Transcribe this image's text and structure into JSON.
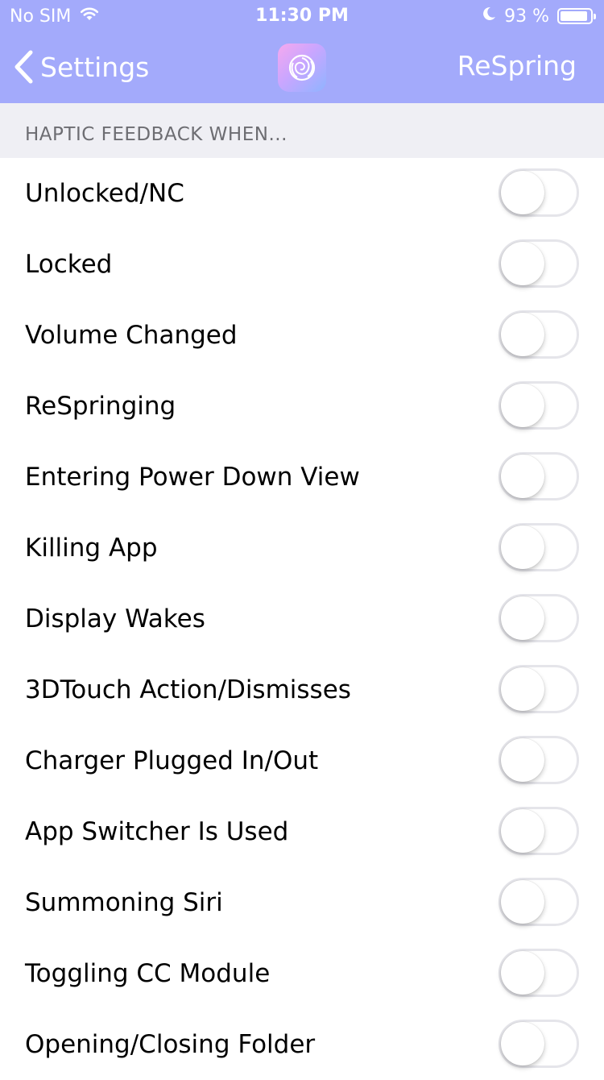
{
  "status_bar": {
    "carrier": "No SIM",
    "time": "11:30 PM",
    "battery_percent": "93 %",
    "battery_level": 0.93,
    "icons": [
      "wifi-icon",
      "moon-icon",
      "battery-icon"
    ]
  },
  "nav": {
    "back_label": "Settings",
    "app_icon": "rose-icon",
    "action_label": "ReSpring"
  },
  "section": {
    "header": "HAPTIC FEEDBACK WHEN..."
  },
  "rows": [
    {
      "label": "Unlocked/NC",
      "on": false
    },
    {
      "label": "Locked",
      "on": false
    },
    {
      "label": "Volume Changed",
      "on": false
    },
    {
      "label": "ReSpringing",
      "on": false
    },
    {
      "label": "Entering Power Down View",
      "on": false
    },
    {
      "label": "Killing App",
      "on": false
    },
    {
      "label": "Display Wakes",
      "on": false
    },
    {
      "label": "3DTouch Action/Dismisses",
      "on": false
    },
    {
      "label": "Charger Plugged In/Out",
      "on": false
    },
    {
      "label": "App Switcher Is Used",
      "on": false
    },
    {
      "label": "Summoning Siri",
      "on": false
    },
    {
      "label": "Toggling CC Module",
      "on": false
    },
    {
      "label": "Opening/Closing Folder",
      "on": false
    }
  ],
  "colors": {
    "nav_background": "#a3aafb",
    "section_background": "#efeff4",
    "switch_off_border": "#e5e5ea",
    "switch_on": "#4cd964"
  }
}
